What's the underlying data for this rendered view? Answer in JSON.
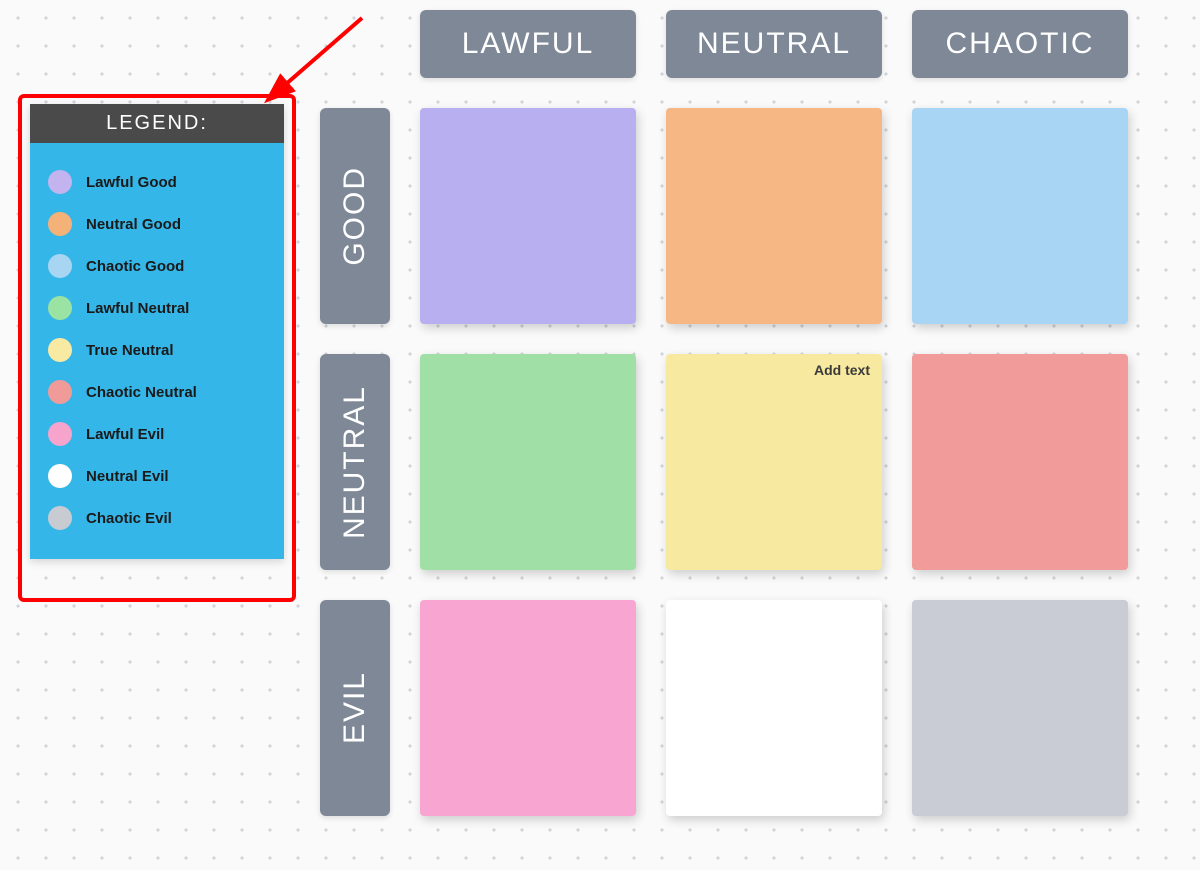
{
  "legend": {
    "title": "LEGEND:",
    "panel_bg": "#35b6e8",
    "header_bg": "#4a4a4a",
    "items": [
      {
        "label": "Lawful Good",
        "color": "#c3b4f0"
      },
      {
        "label": "Neutral Good",
        "color": "#f5b278"
      },
      {
        "label": "Chaotic Good",
        "color": "#a8d5f2"
      },
      {
        "label": "Lawful Neutral",
        "color": "#9be3a3"
      },
      {
        "label": "True Neutral",
        "color": "#f8eaa3"
      },
      {
        "label": "Chaotic Neutral",
        "color": "#f19a9a"
      },
      {
        "label": "Lawful Evil",
        "color": "#f7a4cc"
      },
      {
        "label": "Neutral Evil",
        "color": "#ffffff"
      },
      {
        "label": "Chaotic Evil",
        "color": "#c9cbd2"
      }
    ]
  },
  "annotation": {
    "arrow_color": "#ff0000",
    "highlight_border": "#ff0000"
  },
  "grid": {
    "header_bg": "#7e8896",
    "columns": [
      "LAWFUL",
      "NEUTRAL",
      "CHAOTIC"
    ],
    "rows": [
      "GOOD",
      "NEUTRAL",
      "EVIL"
    ],
    "cells": [
      [
        {
          "color": "#b7afef",
          "hint": ""
        },
        {
          "color": "#f6b785",
          "hint": ""
        },
        {
          "color": "#a9d5f4",
          "hint": ""
        }
      ],
      [
        {
          "color": "#a0e0a6",
          "hint": ""
        },
        {
          "color": "#f7e9a0",
          "hint": "Add text"
        },
        {
          "color": "#f19b9b",
          "hint": ""
        }
      ],
      [
        {
          "color": "#f8a6d1",
          "hint": ""
        },
        {
          "color": "#ffffff",
          "hint": ""
        },
        {
          "color": "#c9ccd4",
          "hint": ""
        }
      ]
    ]
  }
}
